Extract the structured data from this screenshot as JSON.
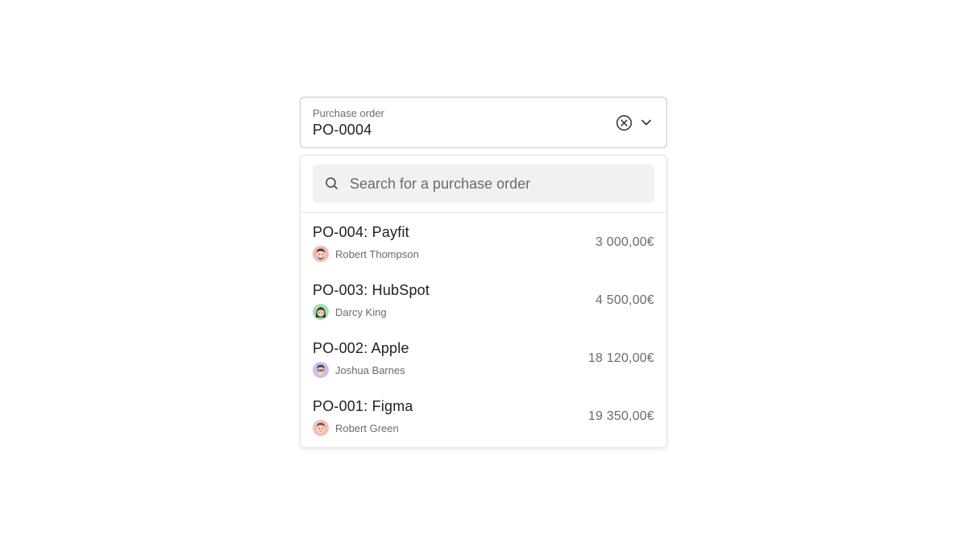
{
  "field": {
    "label": "Purchase order",
    "value": "PO-0004"
  },
  "search": {
    "placeholder": "Search for a purchase order"
  },
  "icons": {
    "clear": "close-circle-icon",
    "expand": "chevron-down-icon",
    "search": "search-icon"
  },
  "orders": [
    {
      "title": "PO-004: Payfit",
      "owner": "Robert Thompson",
      "amount": "3 000,00€",
      "avatar_color": "#f4b6b6"
    },
    {
      "title": "PO-003: HubSpot",
      "owner": "Darcy King",
      "amount": "4 500,00€",
      "avatar_color": "#a9dcae"
    },
    {
      "title": "PO-002: Apple",
      "owner": "Joshua Barnes",
      "amount": "18 120,00€",
      "avatar_color": "#cbbff0"
    },
    {
      "title": "PO-001: Figma",
      "owner": "Robert Green",
      "amount": "19 350,00€",
      "avatar_color": "#f6bcbc"
    }
  ]
}
